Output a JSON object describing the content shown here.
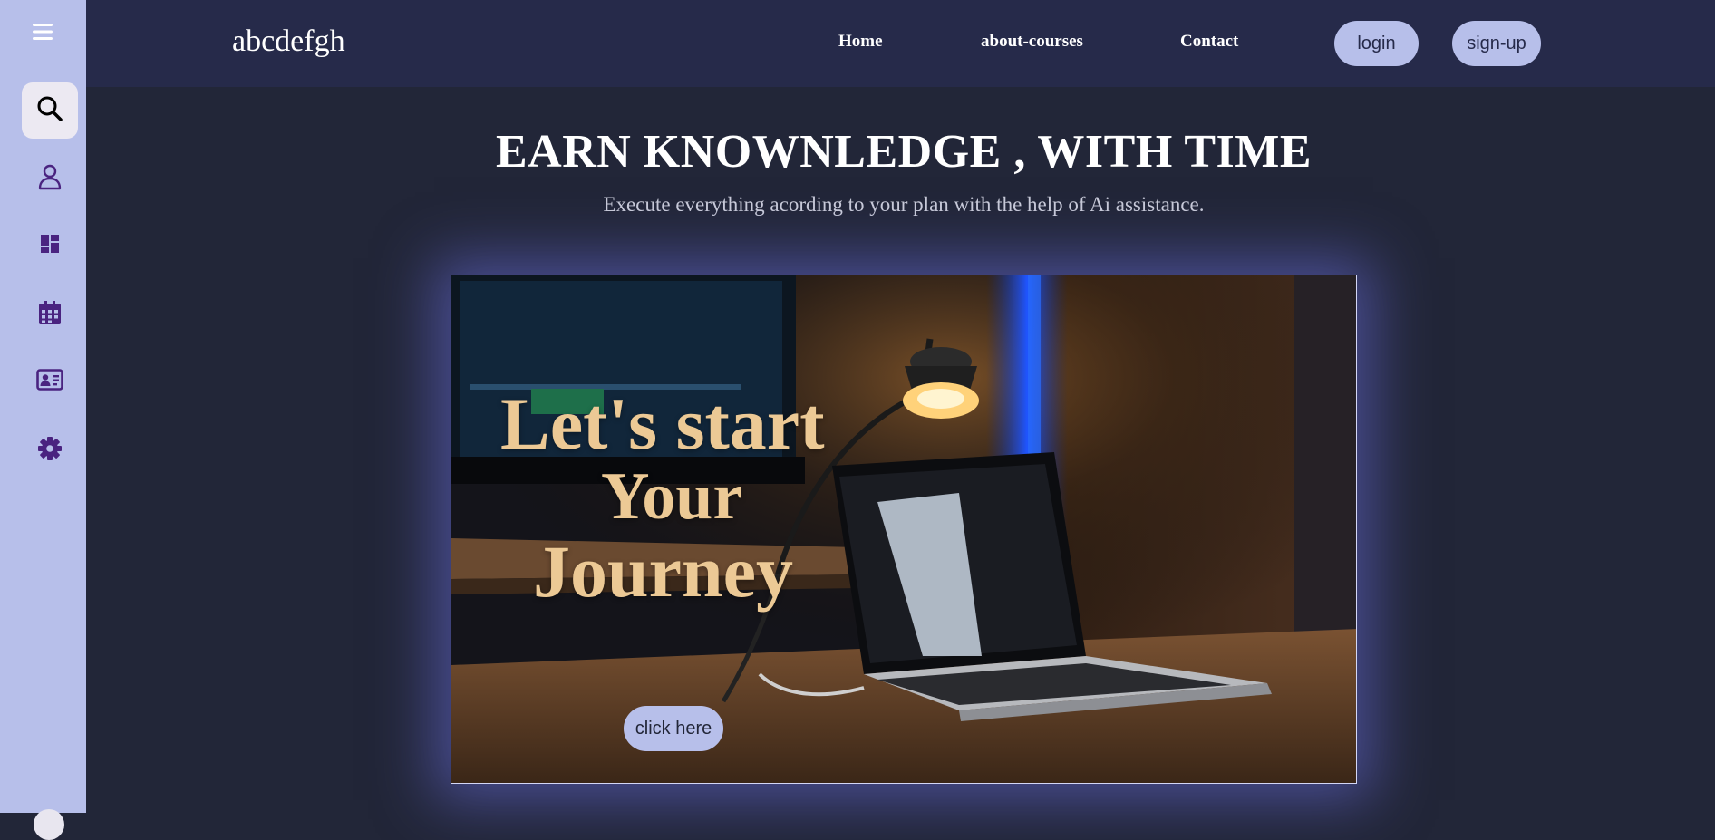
{
  "sidebar": {
    "items": [
      {
        "icon": "search-icon"
      },
      {
        "icon": "user-icon"
      },
      {
        "icon": "dashboard-icon"
      },
      {
        "icon": "calendar-icon"
      },
      {
        "icon": "id-card-icon"
      },
      {
        "icon": "gear-icon"
      }
    ],
    "menu_icon": "hamburger-menu-icon"
  },
  "header": {
    "brand": "abcdefgh",
    "nav": [
      "Home",
      "about-courses",
      "Contact"
    ],
    "login_label": "login",
    "signup_label": "sign-up"
  },
  "hero": {
    "title": "EARN KNOWNLEDGE , WITH TIME",
    "subtitle": "Execute everything acording to your plan with the help of Ai assistance."
  },
  "banner": {
    "lines": [
      "Let's start",
      "Your",
      "Journey"
    ],
    "cta_label": "click here"
  },
  "colors": {
    "page_bg": "#222638",
    "header_bg": "#262a4a",
    "sidebar_bg": "#b7bfea",
    "accent": "#b7bfea",
    "icon_color": "#4a2380",
    "banner_text": "#ecc995"
  }
}
